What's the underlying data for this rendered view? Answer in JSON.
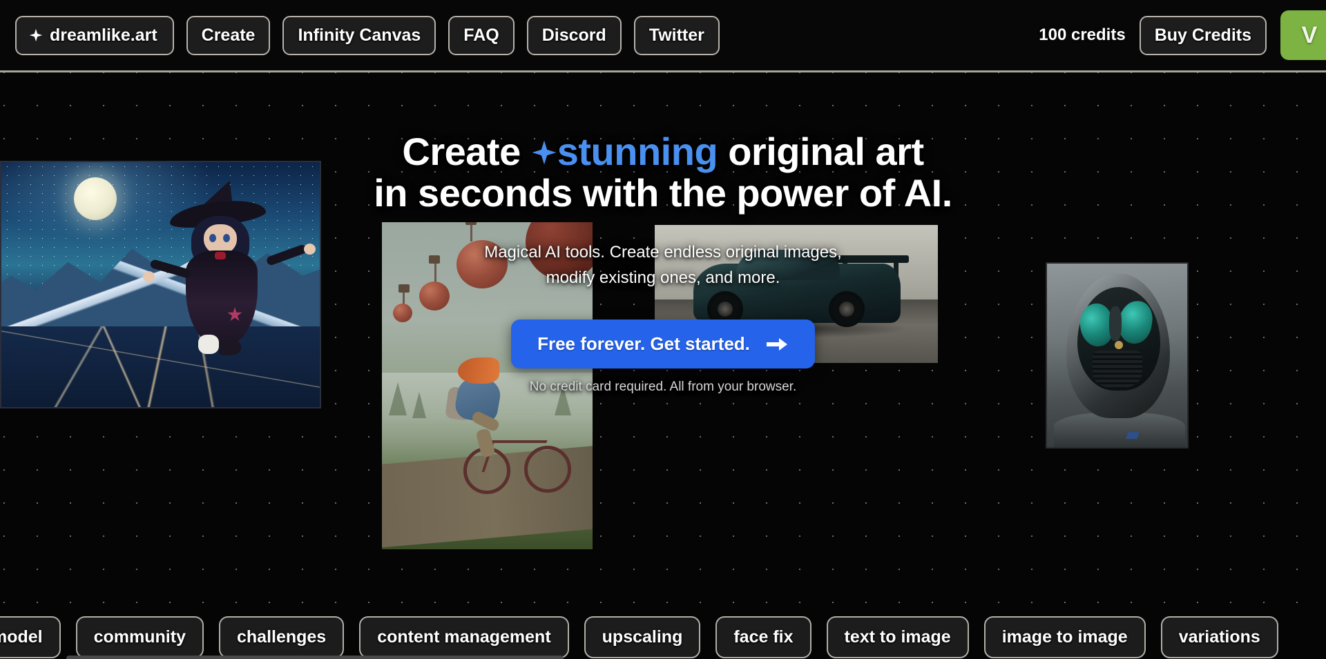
{
  "header": {
    "brand": {
      "label": "dreamlike.art",
      "icon": "sparkle-icon"
    },
    "nav": [
      {
        "label": "Create"
      },
      {
        "label": "Infinity Canvas"
      },
      {
        "label": "FAQ"
      },
      {
        "label": "Discord"
      },
      {
        "label": "Twitter"
      }
    ],
    "credits_label": "100 credits",
    "buy_credits_label": "Buy Credits",
    "avatar_initial": "V",
    "avatar_color": "#7cb342"
  },
  "hero": {
    "headline_part1": "Create ",
    "headline_accent": "stunning",
    "headline_part2": " original art",
    "headline_line2": "in seconds with the power of AI.",
    "accent_color": "#4a90f0",
    "subhead_line1": "Magical AI tools. Create endless original images,",
    "subhead_line2": "modify existing ones, and more.",
    "cta_label": "Free forever. Get started.",
    "cta_color": "#2563eb",
    "disclaimer": "No credit card required. All from your browser."
  },
  "gallery": [
    {
      "name": "anime witch flying over moonlit mountains"
    },
    {
      "name": "cyclist on grassland with floating hot-air spheres"
    },
    {
      "name": "dark teal sports car in industrial lot"
    },
    {
      "name": "alien astronaut in helmet with teal eyes"
    }
  ],
  "tags": [
    {
      "label": "model"
    },
    {
      "label": "community"
    },
    {
      "label": "challenges"
    },
    {
      "label": "content management"
    },
    {
      "label": "upscaling"
    },
    {
      "label": "face fix"
    },
    {
      "label": "text to image"
    },
    {
      "label": "image to image"
    },
    {
      "label": "variations"
    }
  ]
}
